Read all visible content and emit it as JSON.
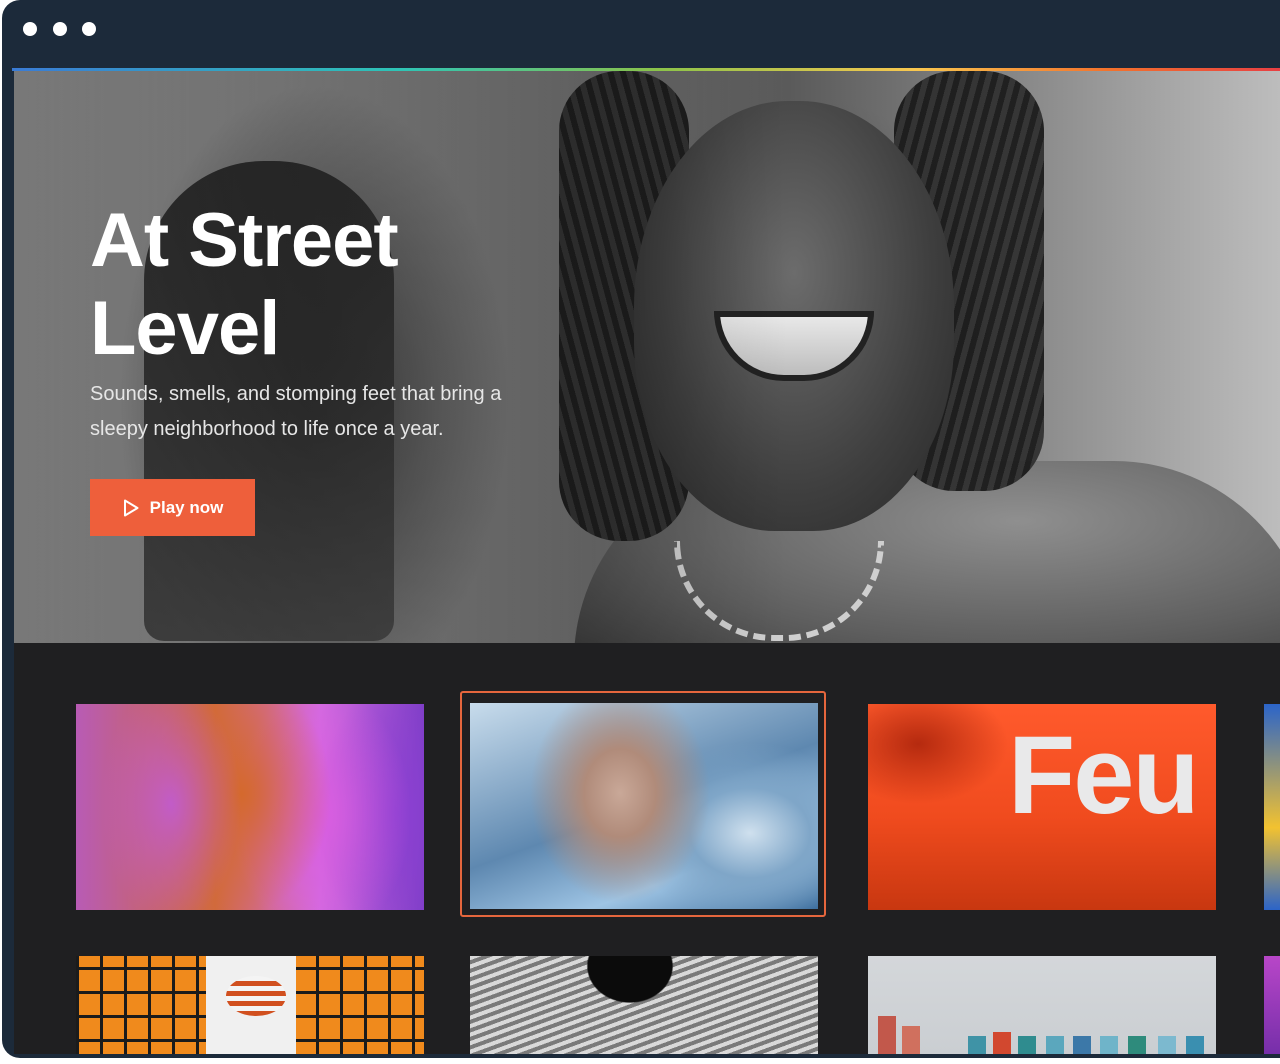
{
  "window": {
    "controls": [
      "window-dot",
      "window-dot",
      "window-dot"
    ]
  },
  "hero": {
    "title_line1": "At Street",
    "title_line2": "Level",
    "subtitle": "Sounds, smells, and stomping feet that bring a sleepy neighborhood to life once a year.",
    "play_label": "Play now",
    "play_icon": "play-icon"
  },
  "cards": {
    "card3_text": "Feu"
  },
  "colors": {
    "accent": "#ee5f3b",
    "window_chrome": "#1c2a3a",
    "page_background": "#1f1f21",
    "selected_border": "#e5663d"
  }
}
